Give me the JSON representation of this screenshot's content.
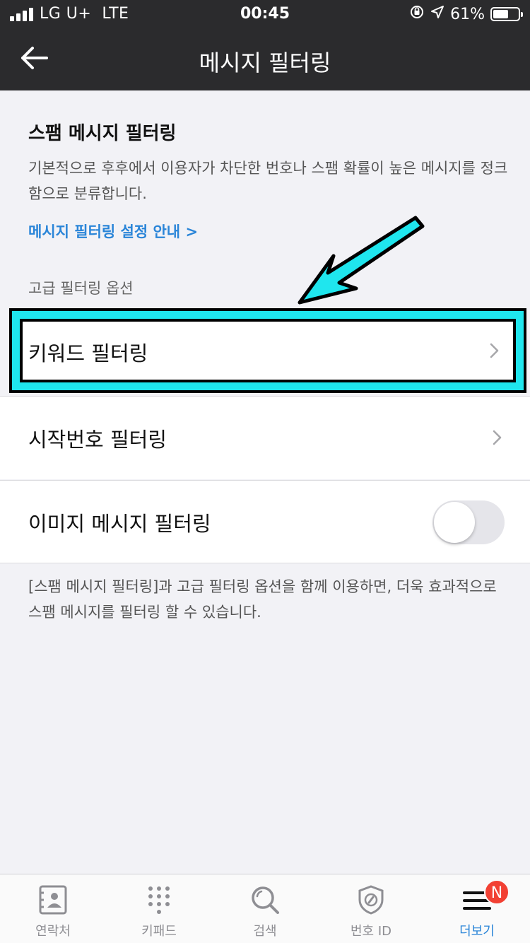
{
  "status_bar": {
    "carrier": "LG U+",
    "network": "LTE",
    "time": "00:45",
    "battery_percent": "61%",
    "battery_level": 0.61
  },
  "nav": {
    "title": "메시지 필터링",
    "back_icon": "back-arrow-icon"
  },
  "spam_section": {
    "title": "스팸 메시지 필터링",
    "description": "기본적으로 후후에서 이용자가 차단한 번호나 스팸 확률이 높은 메시지를 정크함으로 분류합니다.",
    "guide_link": "메시지 필터링 설정 안내 >"
  },
  "advanced": {
    "header": "고급 필터링 옵션",
    "items": [
      {
        "label": "키워드 필터링",
        "control": "chevron"
      },
      {
        "label": "시작번호 필터링",
        "control": "chevron"
      },
      {
        "label": "이미지 메시지 필터링",
        "control": "toggle",
        "enabled": false
      }
    ],
    "footer_note": "[스팸 메시지 필터링]과 고급 필터링 옵션을 함께 이용하면, 더욱 효과적으로 스팸 메시지를 필터링 할 수 있습니다."
  },
  "annotation": {
    "highlight_color": "#1fe6ee"
  },
  "tabs": [
    {
      "label": "연락처",
      "icon": "contacts-icon",
      "active": false
    },
    {
      "label": "키패드",
      "icon": "keypad-icon",
      "active": false
    },
    {
      "label": "검색",
      "icon": "search-icon",
      "active": false
    },
    {
      "label": "번호 ID",
      "icon": "shield-id-icon",
      "active": false
    },
    {
      "label": "더보기",
      "icon": "menu-icon",
      "active": true,
      "badge": "N"
    }
  ],
  "colors": {
    "accent": "#2a85d8",
    "header_bg": "#2b2b2d",
    "badge": "#f24033"
  }
}
